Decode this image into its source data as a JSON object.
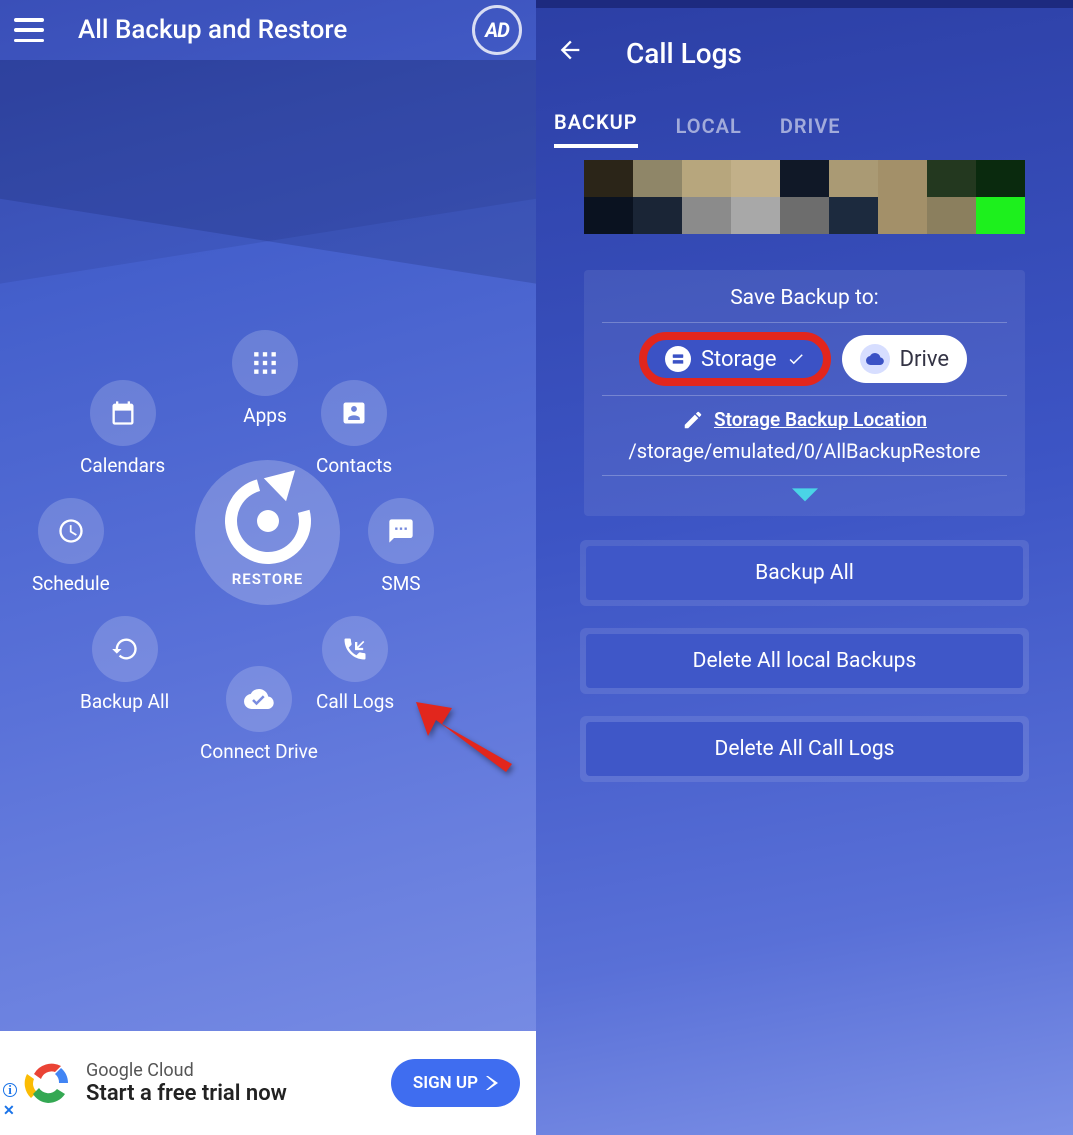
{
  "left": {
    "title": "All Backup and Restore",
    "adBadge": "AD",
    "center": "RESTORE",
    "items": {
      "apps": "Apps",
      "calendars": "Calendars",
      "contacts": "Contacts",
      "schedule": "Schedule",
      "sms": "SMS",
      "backupAll": "Backup All",
      "calllogs": "Call Logs",
      "connect": "Connect Drive"
    },
    "ad": {
      "line1": "Google Cloud",
      "line2": "Start a free trial now",
      "cta": "SIGN UP"
    }
  },
  "right": {
    "title": "Call Logs",
    "tabs": {
      "backup": "BACKUP",
      "local": "LOCAL",
      "drive": "DRIVE"
    },
    "saveTo": "Save Backup to:",
    "dest": {
      "storage": "Storage",
      "drive": "Drive"
    },
    "locationLabel": "Storage Backup Location",
    "path": "/storage/emulated/0/AllBackupRestore",
    "actions": {
      "backupAll": "Backup All",
      "deleteLocal": "Delete All local Backups",
      "deleteLogs": "Delete All Call Logs"
    }
  },
  "pixelColors": [
    "#2b2518",
    "#8f8668",
    "#b7a67d",
    "#c2b089",
    "#101827",
    "#aa9a74",
    "#a39069",
    "#23381f",
    "#0a2a0e",
    "#0a1220",
    "#1a2536",
    "#8b8b8b",
    "#a8a8a8",
    "#6d6d6d",
    "#1c2a3e",
    "#a39069",
    "#8b7f5e",
    "#1df01d"
  ]
}
